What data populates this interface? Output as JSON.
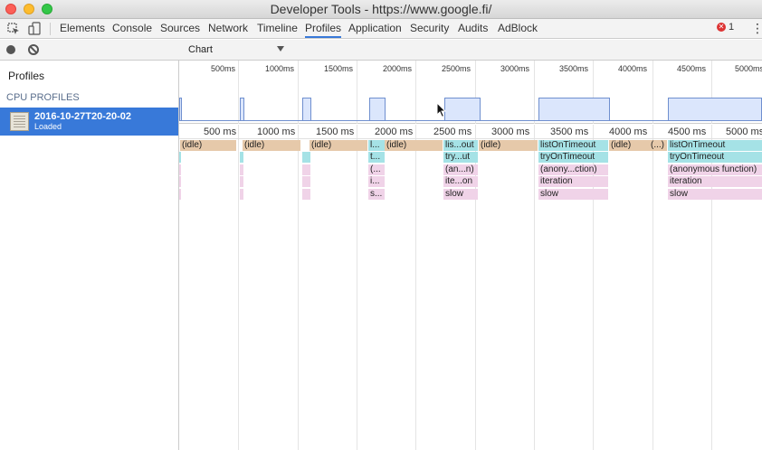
{
  "window": {
    "title": "Developer Tools - https://www.google.fi/"
  },
  "tabs": [
    {
      "label": "Elements",
      "active": false
    },
    {
      "label": "Console",
      "active": false
    },
    {
      "label": "Sources",
      "active": false
    },
    {
      "label": "Network",
      "active": false
    },
    {
      "label": "Timeline",
      "active": false
    },
    {
      "label": "Profiles",
      "active": true
    },
    {
      "label": "Application",
      "active": false
    },
    {
      "label": "Security",
      "active": false
    },
    {
      "label": "Audits",
      "active": false
    },
    {
      "label": "AdBlock",
      "active": false
    }
  ],
  "toolbar": {
    "error_count": "1"
  },
  "sidebar": {
    "heading": "Profiles",
    "section": "CPU PROFILES",
    "profile": {
      "name": "2016-10-27T20-20-02",
      "status": "Loaded"
    }
  },
  "view_select": {
    "value": "Chart"
  },
  "overview_ticks": [
    "500ms",
    "1000ms",
    "1500ms",
    "2000ms",
    "2500ms",
    "3000ms",
    "3500ms",
    "4000ms",
    "4500ms",
    "5000ms"
  ],
  "ruler_ticks": [
    "500 ms",
    "1000 ms",
    "1500 ms",
    "2000 ms",
    "2500 ms",
    "3000 ms",
    "3500 ms",
    "4000 ms",
    "4500 ms",
    "5000 ms"
  ],
  "flame_labels": {
    "idle": "(idle)",
    "ellipsis": "(...)",
    "l_trunc": "l...",
    "lis_out": "lis...out",
    "listOnTimeout": "listOnTimeout",
    "t_trunc": "t...",
    "try_ut": "try...ut",
    "tryOnTimeout": "tryOnTimeout",
    "paren_trunc": "(...",
    "an_n": "(an...n)",
    "anony_ction": "(anony...ction)",
    "anonymous_function": "(anonymous function)",
    "i_trunc": "i...",
    "ite_on": "ite...on",
    "iteration": "iteration",
    "s_trunc": "s...",
    "slow": "slow"
  },
  "colors": {
    "accent": "#3879d9",
    "idle": "#e6c9aa",
    "timer": "#a5e2e6",
    "script": "#f0d3e8",
    "activity": "#dbe6fc"
  }
}
